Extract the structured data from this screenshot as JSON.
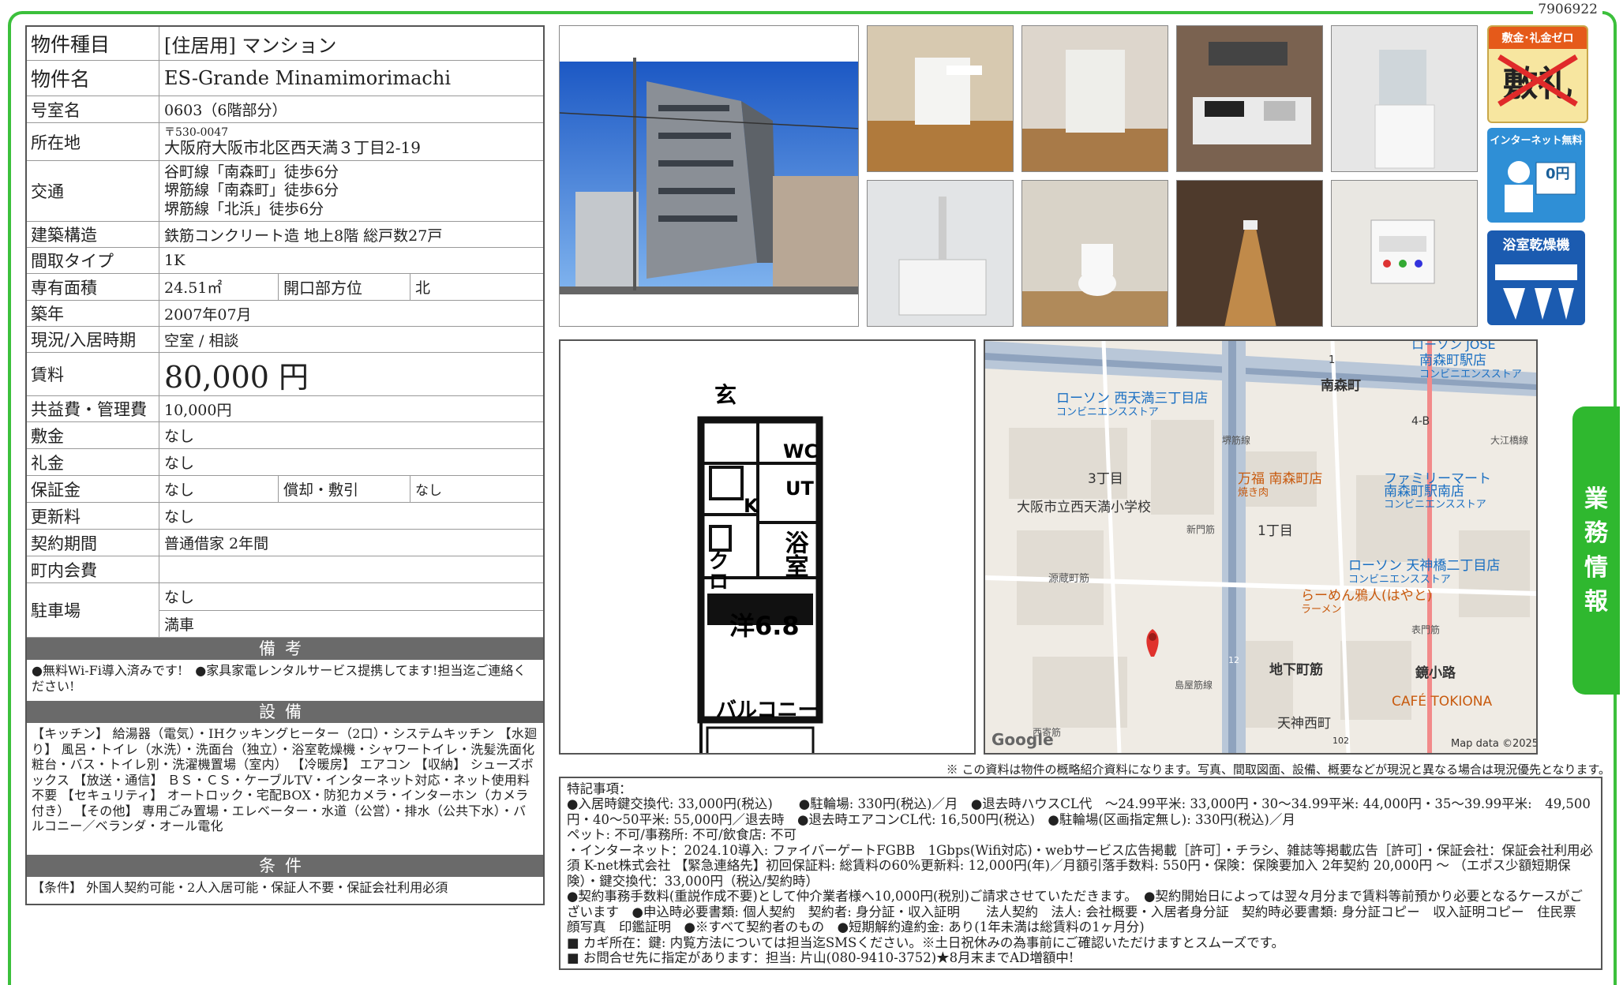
{
  "doc_id": "7906922",
  "side_tab": "業務情報",
  "property": {
    "type_label": "物件種目",
    "type_value": "[住居用] マンション",
    "name_label": "物件名",
    "name_value": "ES-Grande Minamimorimachi",
    "room_label": "号室名",
    "room_value": "0603（6階部分）",
    "address_label": "所在地",
    "address_postal": "〒530-0047",
    "address_value": "大阪府大阪市北区西天満３丁目2-19",
    "transit_label": "交通",
    "transit_lines": [
      "谷町線「南森町」徒歩6分",
      "堺筋線「南森町」徒歩6分",
      "堺筋線「北浜」徒歩6分"
    ],
    "structure_label": "建築構造",
    "structure_value": "鉄筋コンクリート造 地上8階 総戸数27戸",
    "layout_label": "間取タイプ",
    "layout_value": "1K",
    "area_label": "専有面積",
    "area_value": "24.51㎡",
    "direction_label": "開口部方位",
    "direction_value": "北",
    "built_label": "築年",
    "built_value": "2007年07月",
    "status_label": "現況/入居時期",
    "status_value": "空室 / 相談",
    "rent_label": "賃料",
    "rent_value": "80,000 円",
    "fee_label": "共益費・管理費",
    "fee_value": "10,000円",
    "deposit_label": "敷金",
    "deposit_value": "なし",
    "key_money_label": "礼金",
    "key_money_value": "なし",
    "guarantee_label": "保証金",
    "guarantee_value": "なし",
    "amort_label": "償却・敷引",
    "amort_value": "なし",
    "renewal_label": "更新料",
    "renewal_value": "なし",
    "contract_label": "契約期間",
    "contract_value": "普通借家 2年間",
    "town_fee_label": "町内会費",
    "town_fee_value": "",
    "parking_label": "駐車場",
    "parking_value1": "なし",
    "parking_value2": "満車"
  },
  "remarks": {
    "title": "備考",
    "text": "●無料Wi-Fi導入済みです!　●家具家電レンタルサービス提携してます!担当迄ご連絡ください!"
  },
  "equipment": {
    "title": "設備",
    "text": "【キッチン】 給湯器（電気）・IHクッキングヒーター（2口）・システムキッチン 【水廻り】 風呂・トイレ（水洗）・洗面台（独立）・浴室乾燥機・シャワートイレ・洗髪洗面化粧台・バス・トイレ別・洗濯機置場（室内） 【冷暖房】 エアコン 【収納】 シューズボックス 【放送・通信】 ＢＳ・ＣＳ・ケーブルTV・インターネット対応・ネット使用料不要 【セキュリティ】 オートロック・宅配BOX・防犯カメラ・インターホン（カメラ付き） 【その他】 専用ごみ置場・エレベーター・水道（公営）・排水（公共下水）・バルコニー／ベランダ・オール電化"
  },
  "conditions": {
    "title": "条件",
    "text": "【条件】 外国人契約可能・2人入居可能・保証人不要・保証会社利用必須"
  },
  "badges": {
    "b1_title": "敷金･礼金ゼロ",
    "b1_text1": "敷",
    "b1_text2": "礼",
    "b2_title": "インターネット無料",
    "b2_text": "0円",
    "b3_title": "浴室乾燥機"
  },
  "floorplan": {
    "genkan": "玄",
    "wc": "WC",
    "ut": "UT",
    "k": "K",
    "bath": "浴室",
    "closet": "クロ",
    "room": "洋6.8",
    "balcony": "バルコニー"
  },
  "map": {
    "labels": {
      "lawson1": "ローソン 西天満三丁目店",
      "lawson1_sub": "コンビニエンスストア",
      "station": "南森町駅店",
      "station_sub": "コンビニエンスストア",
      "station_top": "ローソン JOSE",
      "minamimorimachi": "南森町",
      "exit1": "1",
      "exit4b": "4-B",
      "sakaisuji": "堺筋線",
      "oe": "大江橋線",
      "banka": "万福 南森町店",
      "banka_sub": "焼き肉",
      "famima": "ファミリーマート",
      "famima2": "南森町駅南店",
      "famima_sub": "コンビニエンスストア",
      "school": "大阪市立西天満小学校",
      "chome3": "3丁目",
      "chome1": "1丁目",
      "shinmichi": "新門筋",
      "lawson2": "ローソン 天神橋二丁目店",
      "lawson2_sub": "コンビニエンスストア",
      "ramen": "らーめん鴉人(はやと)",
      "ramen_sub": "ラーメン",
      "genzo": "源蔵町筋",
      "omote": "表門筋",
      "chikashita": "地下町筋",
      "kagami": "鏡小路",
      "cafe": "CAFÉ TOKIONA",
      "tenjin": "天神西町",
      "road12": "12",
      "road102": "102",
      "google": "Google",
      "mapdata": "Map data ©2025",
      "road": "島屋筋線",
      "nishi": "西寄筋"
    }
  },
  "disclaimer": "※ この資料は物件の概略紹介資料になります。写真、間取図面、設備、概要などが現況と異なる場合は現況優先となります。",
  "special": {
    "heading": "特記事項：",
    "lines": [
      "●入居時鍵交換代: 33,000円(税込)　　●駐輪場: 330円(税込)／月　●退去時ハウスCL代　～24.99平米: 33,000円・30～34.99平米: 44,000円・35～39.99平米:　49,500円・40～50平米: 55,000円／退去時　●退去時エアコンCL代: 16,500円(税込)　●駐輪場(区画指定無し): 330円(税込)／月",
      "ペット: 不可/事務所: 不可/飲食店: 不可",
      "・インターネット：2024.10導入: ファイバーゲートFGBB　1Gbps(Wifi対応)・webサービス広告掲載［許可］・チラシ、雑誌等掲載広告［許可］・保証会社：保証会社利用必須 K-net株式会社 【緊急連絡先】初回保証料: 総賃料の60%更新料: 12,000円(年)／月額引落手数料: 550円・保険：保険要加入 2年契約 20,000円 ～ （エポス少額短期保険）・鍵交換代：33,000円（税込/契約時）",
      "●契約事務手数料(重説作成不要)として仲介業者様へ10,000円(税別)ご請求させていただきます。　●契約開始日によっては翌々月分まで賃料等前預かり必要となるケースがございます　●申込時必要書類: 個人契約　契約者: 身分証・収入証明　　法人契約　法人: 会社概要・入居者身分証　契約時必要書類: 身分証コピー　収入証明コピー　住民票　顔写真　印鑑証明　●※すべて契約者のもの　●短期解約違約金: あり(1年未満は総賃料の1ヶ月分)",
      "■ カギ所在：鍵: 内覧方法については担当迄SMSください。※土日祝休みの為事前にご確認いただけますとスムーズです。",
      "■ お問合せ先に指定があります：担当: 片山(080-9410-3752)★8月末までAD増額中!"
    ]
  }
}
